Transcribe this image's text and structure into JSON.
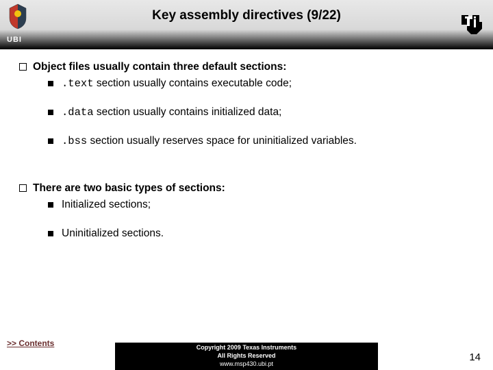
{
  "header": {
    "title": "Key assembly directives (9/22)",
    "ubi_label": "UBI"
  },
  "content": {
    "group1": {
      "heading": "Object files usually contain three default sections:",
      "items": [
        {
          "code": ".text",
          "rest": " section usually contains executable code;"
        },
        {
          "code": ".data",
          "rest": " section usually contains initialized data;"
        },
        {
          "code": ".bss",
          "rest": " section usually reserves space for uninitialized variables."
        }
      ]
    },
    "group2": {
      "heading": "There are two basic types of sections:",
      "items": [
        {
          "text": "Initialized sections;"
        },
        {
          "text": "Uninitialized sections."
        }
      ]
    }
  },
  "footer": {
    "contents_link": ">> Contents",
    "copyright_line1": "Copyright 2009 Texas Instruments",
    "copyright_line2": "All Rights Reserved",
    "url": "www.msp430.ubi.pt",
    "page_number": "14"
  }
}
